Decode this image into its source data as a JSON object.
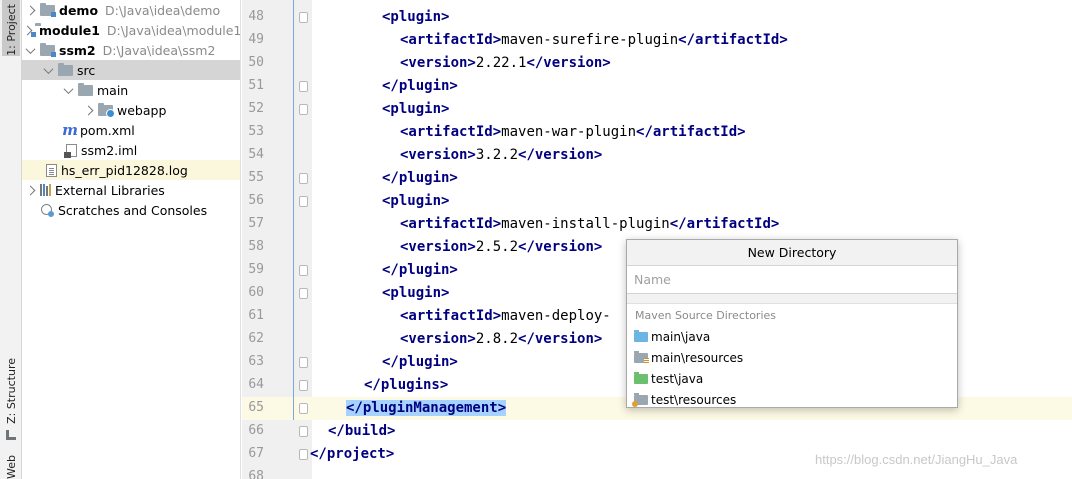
{
  "stripe": {
    "project_tab": "1: Project",
    "structure_tab": "Z: Structure",
    "web_tab": "Web"
  },
  "tree": {
    "items": [
      {
        "label": "demo",
        "path": "D:\\Java\\idea\\demo"
      },
      {
        "label": "module1",
        "path": "D:\\Java\\idea\\module1"
      },
      {
        "label": "ssm2",
        "path": "D:\\Java\\idea\\ssm2"
      },
      {
        "label": "src"
      },
      {
        "label": "main"
      },
      {
        "label": "webapp"
      },
      {
        "label": "pom.xml"
      },
      {
        "label": "ssm2.iml"
      },
      {
        "label": "hs_err_pid12828.log"
      },
      {
        "label": "External Libraries"
      },
      {
        "label": "Scratches and Consoles"
      }
    ]
  },
  "editor": {
    "lines": [
      {
        "n": "48",
        "open": "<plugin>"
      },
      {
        "n": "49",
        "open": "<artifactId>",
        "text": "maven-surefire-plugin",
        "close": "</artifactId>"
      },
      {
        "n": "50",
        "open": "<version>",
        "text": "2.22.1",
        "close": "</version>"
      },
      {
        "n": "51",
        "open": "</plugin>"
      },
      {
        "n": "52",
        "open": "<plugin>"
      },
      {
        "n": "53",
        "open": "<artifactId>",
        "text": "maven-war-plugin",
        "close": "</artifactId>"
      },
      {
        "n": "54",
        "open": "<version>",
        "text": "3.2.2",
        "close": "</version>"
      },
      {
        "n": "55",
        "open": "</plugin>"
      },
      {
        "n": "56",
        "open": "<plugin>"
      },
      {
        "n": "57",
        "open": "<artifactId>",
        "text": "maven-install-plugin",
        "close": "</artifactId>"
      },
      {
        "n": "58",
        "open": "<version>",
        "text": "2.5.2",
        "close": "</version>"
      },
      {
        "n": "59",
        "open": "</plugin>"
      },
      {
        "n": "60",
        "open": "<plugin>"
      },
      {
        "n": "61",
        "open": "<artifactId>",
        "text": "maven-deploy-"
      },
      {
        "n": "62",
        "open": "<version>",
        "text": "2.8.2",
        "close": "</version>"
      },
      {
        "n": "63",
        "open": "</plugin>"
      },
      {
        "n": "64",
        "open": "</plugins>"
      },
      {
        "n": "65",
        "open": "</pluginManagement>"
      },
      {
        "n": "66",
        "open": "</build>"
      },
      {
        "n": "67",
        "open": "</project>"
      },
      {
        "n": "68"
      }
    ]
  },
  "popup": {
    "title": "New Directory",
    "name_placeholder": "Name",
    "section_label": "Maven Source Directories",
    "options": [
      {
        "label": "main\\java",
        "color": "#6cb4e4"
      },
      {
        "label": "main\\resources",
        "color": "#9aa7b0"
      },
      {
        "label": "test\\java",
        "color": "#6cbf6c"
      },
      {
        "label": "test\\resources",
        "color": "#9aa7b0"
      }
    ]
  },
  "watermark": "https://blog.csdn.net/JiangHu_Java",
  "colors": {
    "xml_tag": "#000080",
    "selection": "#a6d2ff",
    "current_line": "#fcfae4",
    "tree_selection": "#d5d5d5"
  }
}
